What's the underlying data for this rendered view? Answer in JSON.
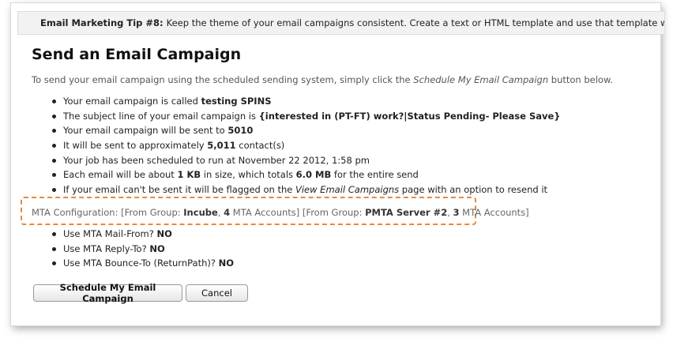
{
  "tip": {
    "label": "Email Marketing Tip #8:",
    "text": "Keep the theme of your email campaigns consistent. Create a text or HTML template and use that template whenever you create"
  },
  "page_title": "Send an Email Campaign",
  "intro": {
    "before": "To send your email campaign using the scheduled sending system, simply click the ",
    "emph": "Schedule My Email Campaign",
    "after": " button below."
  },
  "bullets": [
    {
      "pre": "Your email campaign is called ",
      "bold": "testing SPINS",
      "post": ""
    },
    {
      "pre": "The subject line of your email campaign is ",
      "bold": "{interested in (PT-FT) work?|Status Pending- Please Save}",
      "post": ""
    },
    {
      "pre": "Your email campaign will be sent to ",
      "bold": "5010",
      "post": ""
    },
    {
      "pre": "It will be sent to approximately ",
      "bold": "5,011",
      "post": " contact(s)"
    },
    {
      "pre": "Your job has been scheduled to run at November 22 2012, 1:58 pm",
      "bold": "",
      "post": ""
    },
    {
      "pre": "Each email will be about ",
      "bold": "1 KB",
      "mid": " in size, which totals ",
      "bold2": "6.0 MB",
      "post": " for the entire send"
    },
    {
      "pre": "If your email can't be sent it will be flagged on the ",
      "emph": "View Email Campaigns",
      "post": " page with an option to resend it"
    }
  ],
  "mta": {
    "prefix": "MTA Configuration: [From Group: ",
    "group1": "Incube",
    "sep1": ", ",
    "count1": "4",
    "mid": " MTA Accounts] [From Group: ",
    "group2": "PMTA Server #2",
    "sep2": ", ",
    "count2": "3",
    "suffix": " MTA Accounts]"
  },
  "mta_options": [
    {
      "label": "Use MTA Mail-From? ",
      "value": "NO"
    },
    {
      "label": "Use MTA Reply-To? ",
      "value": "NO"
    },
    {
      "label": "Use MTA Bounce-To (ReturnPath)? ",
      "value": "NO"
    }
  ],
  "buttons": {
    "schedule": "Schedule My Email Campaign",
    "cancel": "Cancel"
  },
  "colors": {
    "highlight": "#e58a3c",
    "tip_bg": "#f2f2f2"
  },
  "icons": {
    "tip": "lightbulb-icon"
  }
}
